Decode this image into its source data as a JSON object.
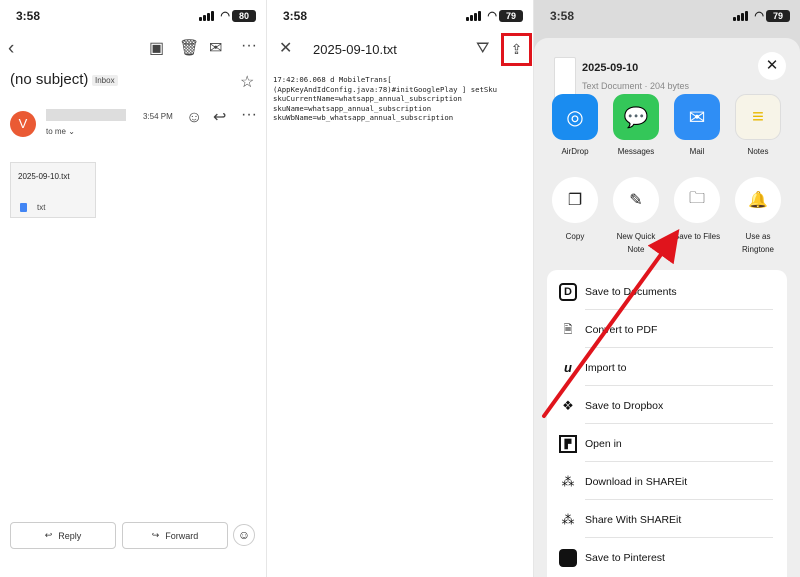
{
  "panel1": {
    "status_time": "3:58",
    "battery": "80",
    "subject": "(no subject)",
    "badge": "Inbox",
    "avatar_letter": "V",
    "recipient": "to me",
    "time": "3:54 PM",
    "attachment_name": "2025-09-10.txt",
    "attachment_type": "txt",
    "reply_label": "Reply",
    "forward_label": "Forward"
  },
  "panel2": {
    "status_time": "3:58",
    "battery": "79",
    "title": "2025-09-10.txt",
    "content": "17:42:06.068 d MobileTrans[\n(AppKeyAndIdConfig.java:78)#initGooglePlay ] setSku\nskuCurrentName=whatsapp_annual_subscription\nskuName=whatsapp_annual_subscription\nskuWbName=wb_whatsapp_annual_subscription"
  },
  "panel3": {
    "status_time": "3:58",
    "battery": "79",
    "file_title": "2025-09-10",
    "file_sub": "Text Document · 204 bytes",
    "apps": [
      {
        "label": "AirDrop",
        "color": "#1a8cf0",
        "icon": "airdrop-icon"
      },
      {
        "label": "Messages",
        "color": "#34c759",
        "icon": "messages-icon"
      },
      {
        "label": "Mail",
        "color": "#2f8ef5",
        "icon": "mail-icon"
      },
      {
        "label": "Notes",
        "color": "#f7f4e8",
        "icon": "notes-icon"
      }
    ],
    "actions": [
      {
        "label": "Copy",
        "label2": "",
        "icon": "copy-icon"
      },
      {
        "label": "New Quick",
        "label2": "Note",
        "icon": "quick-note-icon"
      },
      {
        "label": "Save to Files",
        "label2": "",
        "icon": "folder-icon"
      },
      {
        "label": "Use as",
        "label2": "Ringtone",
        "icon": "bell-icon"
      }
    ],
    "list": [
      {
        "label": "Save to Documents",
        "icon": "documents-icon"
      },
      {
        "label": "Convert to PDF",
        "icon": "pdf-icon"
      },
      {
        "label": "Import to",
        "icon": "import-icon"
      },
      {
        "label": "Save to Dropbox",
        "icon": "dropbox-icon"
      },
      {
        "label": "Open in",
        "icon": "open-in-icon"
      },
      {
        "label": "Download in SHAREit",
        "icon": "shareit-icon"
      },
      {
        "label": "Share With SHAREit",
        "icon": "shareit-icon"
      },
      {
        "label": "Save to Pinterest",
        "icon": "pinterest-icon"
      }
    ]
  },
  "colors": {
    "accent_red": "#e0141c",
    "avatar": "#ea5a34"
  }
}
